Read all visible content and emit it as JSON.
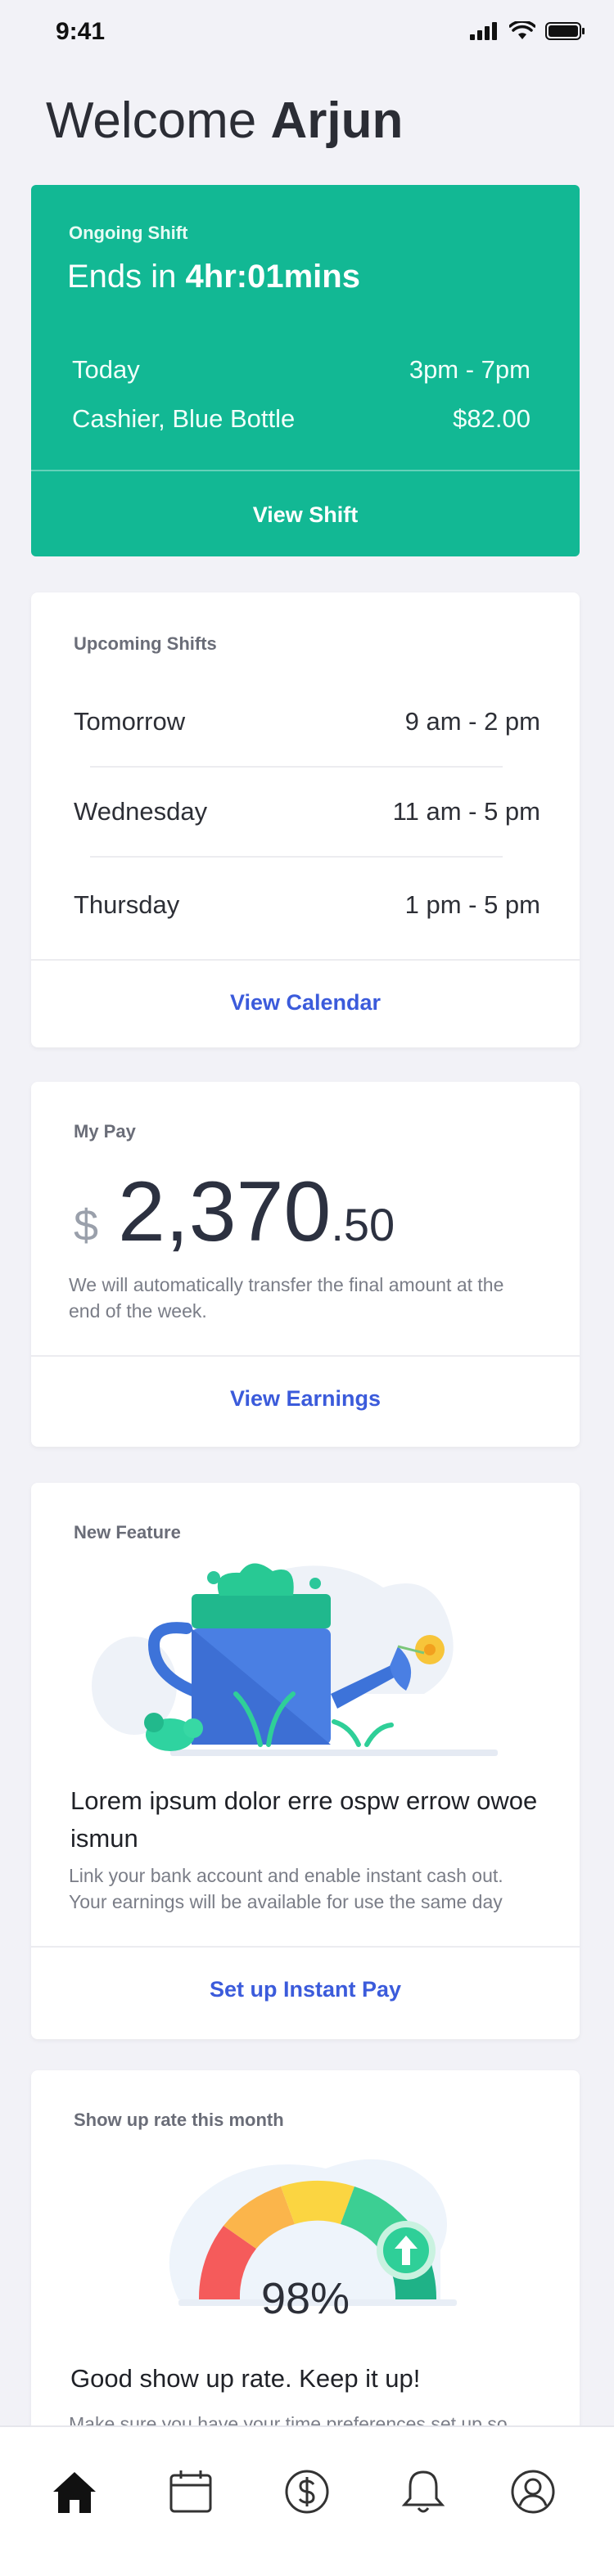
{
  "status": {
    "time": "9:41"
  },
  "welcome": {
    "prefix": "Welcome",
    "name": "Arjun"
  },
  "ongoing": {
    "label": "Ongoing Shift",
    "ends_prefix": "Ends in",
    "ends_value": "4hr:01mins",
    "day": "Today",
    "hours": "3pm - 7pm",
    "role": "Cashier, Blue Bottle",
    "amount": "$82.00",
    "action": "View Shift"
  },
  "upcoming": {
    "title": "Upcoming Shifts",
    "shifts": [
      {
        "day": "Tomorrow",
        "time": "9 am - 2 pm"
      },
      {
        "day": "Wednesday",
        "time": "11 am - 5 pm"
      },
      {
        "day": "Thursday",
        "time": "1 pm - 5 pm"
      }
    ],
    "action": "View Calendar"
  },
  "pay": {
    "title": "My Pay",
    "currency": "$",
    "whole": "2,370",
    "cents": ".50",
    "note": "We will automatically transfer the final amount at the end of the week.",
    "action": "View Earnings"
  },
  "feature": {
    "title": "New Feature",
    "headline": "Lorem ipsum dolor erre ospw errow owoe ismun",
    "description": "Link your bank account and enable instant cash out. Your earnings will be available for use the same day",
    "action": "Set up Instant Pay"
  },
  "showup": {
    "title": "Show up rate this month",
    "rate_percent": 98,
    "rate_label": "98%",
    "headline": "Good show up rate. Keep it up!",
    "description": "Make sure you have your time preferences set up so"
  },
  "colors": {
    "brand_green": "#12b894",
    "link_blue": "#3b5bdb",
    "background": "#f2f2f7"
  },
  "tabs": [
    {
      "name": "home-icon",
      "active": true
    },
    {
      "name": "calendar-icon",
      "active": false
    },
    {
      "name": "dollar-icon",
      "active": false
    },
    {
      "name": "bell-icon",
      "active": false
    },
    {
      "name": "profile-icon",
      "active": false
    }
  ]
}
